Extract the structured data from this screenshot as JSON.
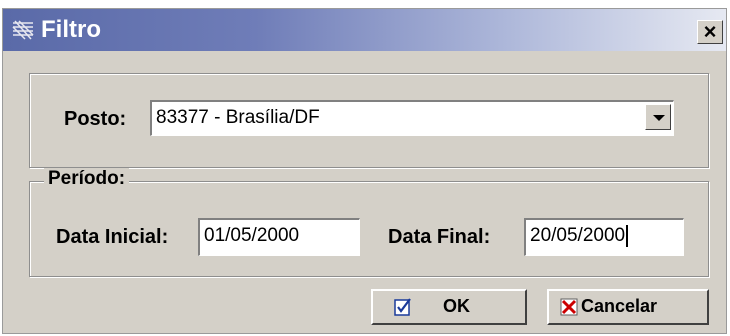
{
  "window": {
    "title": "Filtro",
    "close_glyph": "×"
  },
  "posto": {
    "label": "Posto:",
    "selected": "83377 - Brasília/DF"
  },
  "periodo": {
    "legend": "Período:",
    "data_inicial_label": "Data Inicial:",
    "data_inicial_value": "01/05/2000",
    "data_final_label": "Data Final:",
    "data_final_value": "20/05/2000"
  },
  "buttons": {
    "ok_label": "OK",
    "cancel_label": "Cancelar"
  },
  "icons": {
    "app": "app-grid-icon",
    "close": "close-icon",
    "dropdown": "chevron-down-icon",
    "ok": "checkmark-icon",
    "cancel": "x-mark-icon"
  },
  "colors": {
    "titlebar_start": "#5a6aa8",
    "titlebar_end": "#e6e9f2",
    "dialog_face": "#d4d0c8",
    "cancel_icon": "#cc0000",
    "ok_icon": "#1a3a9a"
  }
}
